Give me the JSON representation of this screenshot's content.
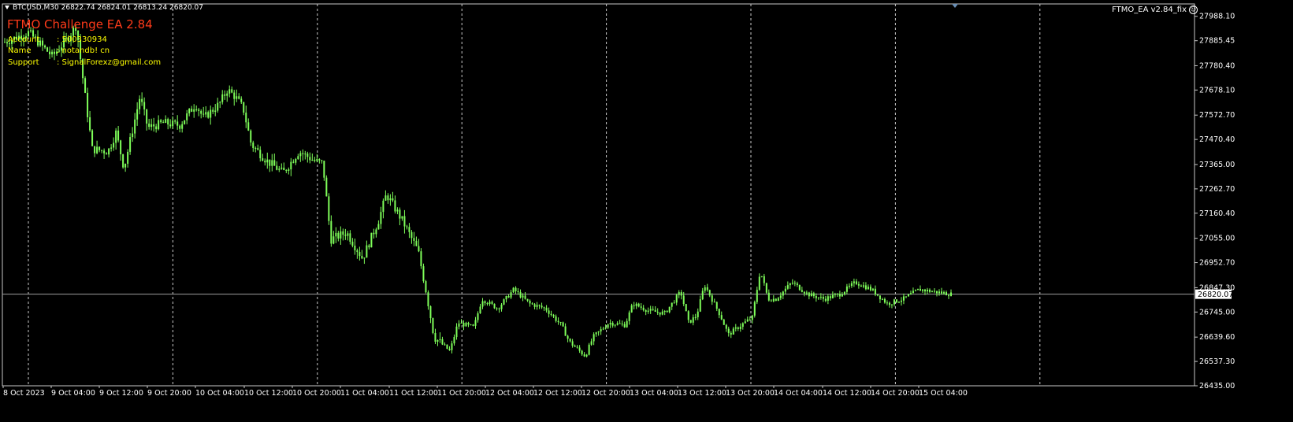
{
  "header": {
    "symbol": "BTCUSD,M30",
    "ohlc": "26822.74 26824.01 26813.24 26820.07"
  },
  "ea_panel": {
    "title": "FTMO Challenge EA 2.84",
    "rows": [
      {
        "label": "Account",
        "value": ": 500330934"
      },
      {
        "label": "Name",
        "value": ": notandb! cn"
      },
      {
        "label": "Support",
        "value": ": SignalForexz@gmail.com"
      }
    ]
  },
  "ea_badge": {
    "label": "FTMO_EA  v2.84_fix",
    "icon": "smiley-icon"
  },
  "colors": {
    "background": "#000000",
    "candle": "#7fff5a",
    "grid": "#c8c8c8",
    "text": "#ffffff",
    "panel_text": "#ffff00",
    "title_text": "#ff3b1a",
    "price_line": "#a0a0a0"
  },
  "chart_data": {
    "type": "candlestick",
    "symbol": "BTCUSD",
    "timeframe": "M30",
    "current_price": "26820.07",
    "ylim": [
      26435.0,
      28040.0
    ],
    "price_ticks": [
      "27988.10",
      "27885.45",
      "27780.40",
      "27678.10",
      "27572.70",
      "27470.40",
      "27365.00",
      "27262.70",
      "27160.40",
      "27055.00",
      "26952.70",
      "26847.30",
      "26745.00",
      "26639.60",
      "26537.30",
      "26435.00"
    ],
    "time_ticks": [
      "8 Oct 2023",
      "9 Oct 04:00",
      "9 Oct 12:00",
      "9 Oct 20:00",
      "10 Oct 04:00",
      "10 Oct 12:00",
      "10 Oct 20:00",
      "11 Oct 04:00",
      "11 Oct 12:00",
      "11 Oct 20:00",
      "12 Oct 04:00",
      "12 Oct 12:00",
      "12 Oct 20:00",
      "13 Oct 04:00",
      "13 Oct 12:00",
      "13 Oct 20:00",
      "14 Oct 04:00",
      "14 Oct 12:00",
      "14 Oct 20:00",
      "15 Oct 04:00"
    ],
    "price_path": [
      [
        0,
        27880
      ],
      [
        6,
        27920
      ],
      [
        12,
        27820
      ],
      [
        16,
        27900
      ],
      [
        18,
        27950
      ],
      [
        20,
        27680
      ],
      [
        22,
        27430
      ],
      [
        26,
        27420
      ],
      [
        28,
        27500
      ],
      [
        30,
        27350
      ],
      [
        32,
        27500
      ],
      [
        34,
        27650
      ],
      [
        36,
        27520
      ],
      [
        40,
        27540
      ],
      [
        44,
        27530
      ],
      [
        48,
        27620
      ],
      [
        50,
        27560
      ],
      [
        54,
        27620
      ],
      [
        56,
        27680
      ],
      [
        58,
        27650
      ],
      [
        60,
        27600
      ],
      [
        62,
        27450
      ],
      [
        66,
        27380
      ],
      [
        70,
        27330
      ],
      [
        74,
        27420
      ],
      [
        78,
        27380
      ],
      [
        80,
        27370
      ],
      [
        82,
        27050
      ],
      [
        86,
        27080
      ],
      [
        90,
        26970
      ],
      [
        94,
        27130
      ],
      [
        96,
        27240
      ],
      [
        100,
        27130
      ],
      [
        104,
        27000
      ],
      [
        106,
        26830
      ],
      [
        108,
        26640
      ],
      [
        112,
        26580
      ],
      [
        114,
        26700
      ],
      [
        118,
        26680
      ],
      [
        120,
        26800
      ],
      [
        124,
        26760
      ],
      [
        128,
        26840
      ],
      [
        132,
        26780
      ],
      [
        136,
        26760
      ],
      [
        140,
        26690
      ],
      [
        142,
        26620
      ],
      [
        146,
        26560
      ],
      [
        148,
        26640
      ],
      [
        152,
        26700
      ],
      [
        156,
        26690
      ],
      [
        158,
        26780
      ],
      [
        162,
        26750
      ],
      [
        166,
        26740
      ],
      [
        170,
        26830
      ],
      [
        172,
        26700
      ],
      [
        174,
        26730
      ],
      [
        176,
        26860
      ],
      [
        180,
        26730
      ],
      [
        182,
        26650
      ],
      [
        186,
        26700
      ],
      [
        188,
        26720
      ],
      [
        190,
        26920
      ],
      [
        192,
        26800
      ],
      [
        194,
        26800
      ],
      [
        198,
        26870
      ],
      [
        202,
        26820
      ],
      [
        206,
        26800
      ],
      [
        210,
        26820
      ],
      [
        214,
        26870
      ],
      [
        218,
        26840
      ],
      [
        222,
        26780
      ],
      [
        226,
        26800
      ],
      [
        230,
        26840
      ],
      [
        234,
        26830
      ],
      [
        238,
        26820
      ]
    ]
  }
}
